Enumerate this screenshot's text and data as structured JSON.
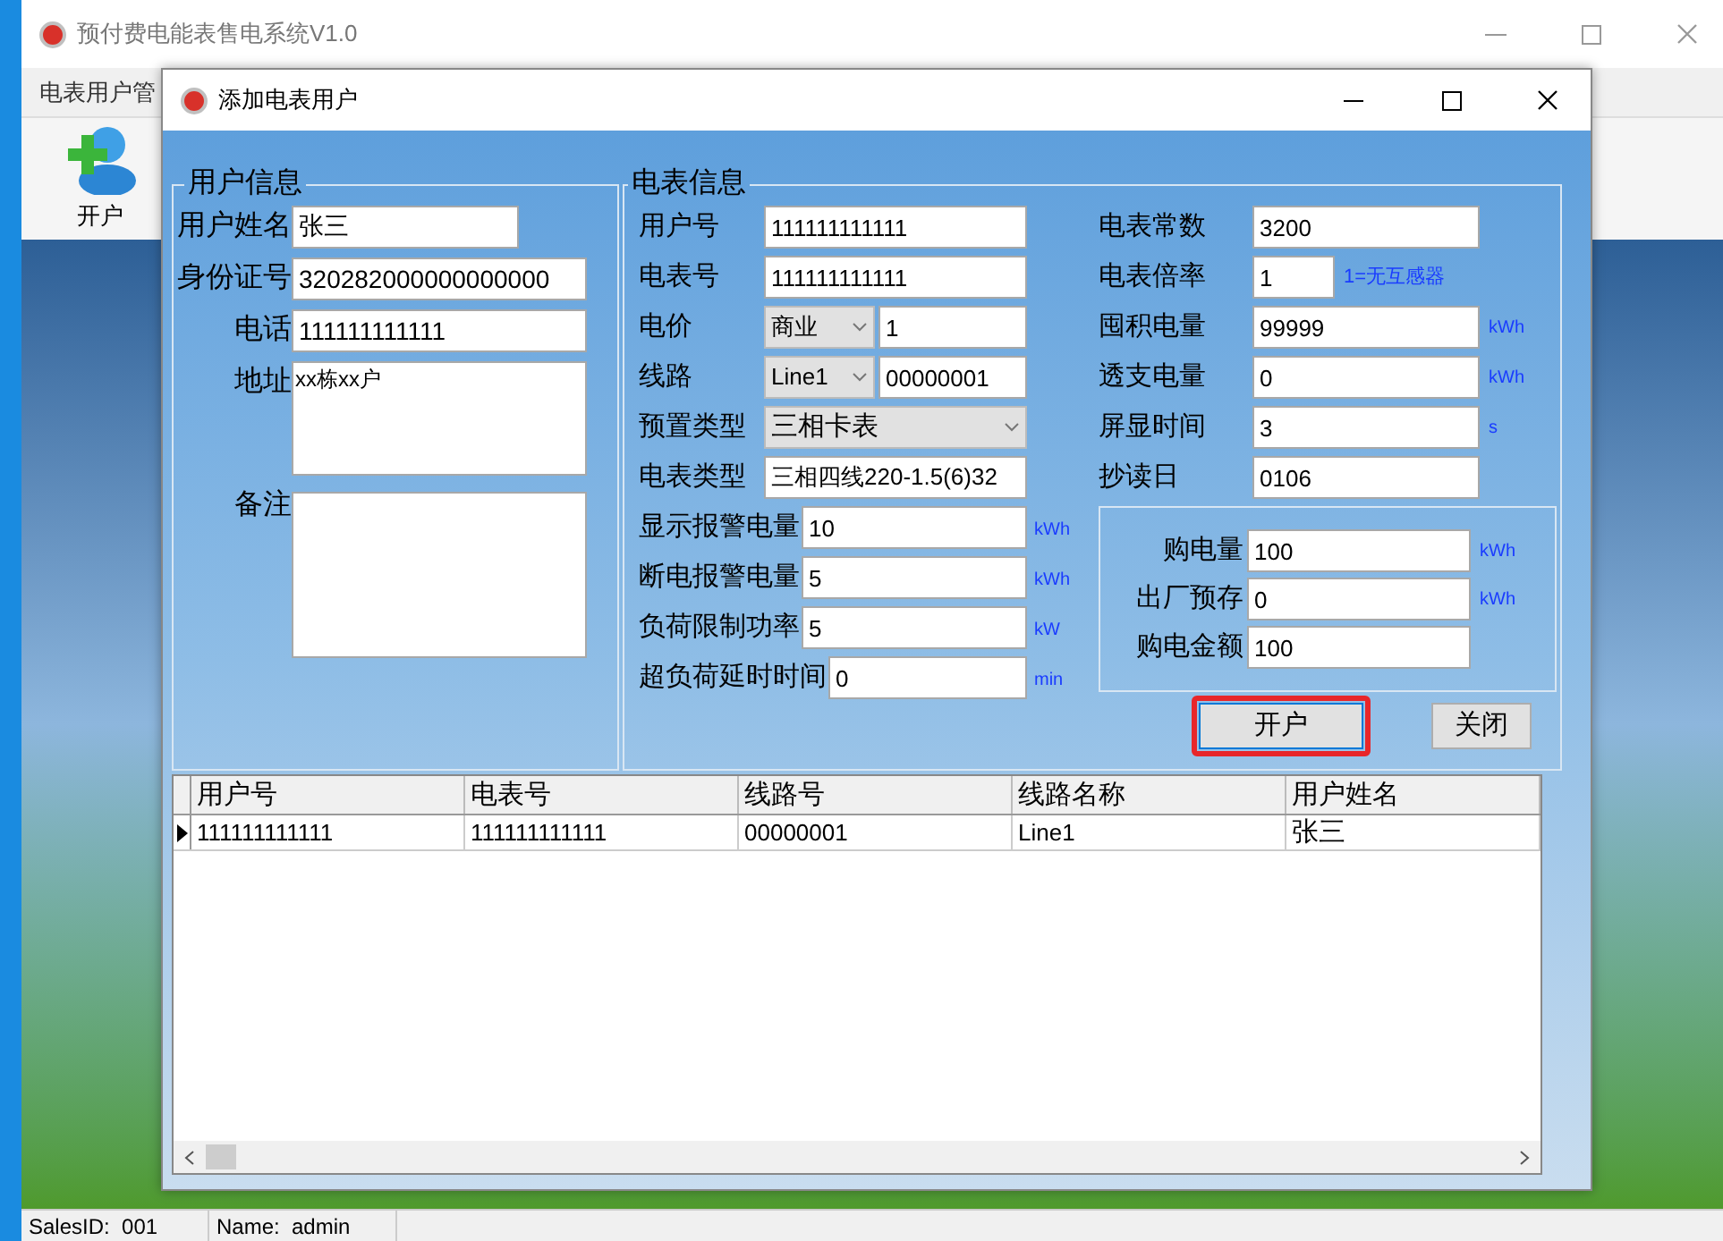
{
  "main_window": {
    "title": "预付费电能表售电系统V1.0",
    "menu": [
      "电表用户管"
    ],
    "toolbar": [
      {
        "label": "开户"
      }
    ],
    "status_bar": [
      "SalesID:  001",
      "Name:  admin"
    ]
  },
  "dialog": {
    "title": "添加电表用户",
    "user_info": {
      "legend": "用户信息",
      "fields": [
        {
          "kind": "input",
          "label": "用户姓名",
          "value": "张三",
          "short": true
        },
        {
          "kind": "input",
          "label": "身份证号",
          "value": "320282000000000000",
          "short": false
        },
        {
          "kind": "input",
          "label": "电话",
          "value": "111111111111",
          "short": false
        },
        {
          "kind": "textarea",
          "label": "地址",
          "value": "xx栋xx户"
        },
        {
          "kind": "textarea",
          "label": "备注"
        }
      ]
    },
    "meter_info": {
      "legend": "电表信息",
      "left_fields": [
        {
          "kind": "input",
          "label": "用户号",
          "value": "111111111111"
        },
        {
          "kind": "input",
          "label": "电表号",
          "value": "111111111111"
        },
        {
          "kind": "combo-input",
          "label": "电价",
          "option": "商业",
          "value": "1"
        },
        {
          "kind": "combo-input",
          "label": "线路",
          "option": "Line1",
          "value": "00000001"
        },
        {
          "kind": "combo",
          "label": "预置类型",
          "option": "三相卡表"
        },
        {
          "kind": "input",
          "label": "电表类型",
          "value": "三相四线220-1.5(6)32"
        },
        {
          "kind": "input",
          "label": "显示报警电量",
          "value": "10",
          "unit": "kWh"
        },
        {
          "kind": "input",
          "label": "断电报警电量",
          "value": "5",
          "unit": "kWh"
        },
        {
          "kind": "input",
          "label": "负荷限制功率",
          "value": "5",
          "unit": "kW"
        },
        {
          "kind": "input",
          "label": "超负荷延时时间",
          "value": "0",
          "unit": "min"
        }
      ],
      "right_fields": [
        {
          "label": "电表常数",
          "value": "3200"
        },
        {
          "label": "电表倍率",
          "value": "1",
          "note": "1=无互感器"
        },
        {
          "label": "囤积电量",
          "value": "99999",
          "unit": "kWh"
        },
        {
          "label": "透支电量",
          "value": "0",
          "unit": "kWh"
        },
        {
          "label": "屏显时间",
          "value": "3",
          "unit": "s"
        },
        {
          "label": "抄读日",
          "value": "0106"
        }
      ],
      "purchase": [
        {
          "label": "购电量",
          "value": "100",
          "unit": "kWh"
        },
        {
          "label": "出厂预存",
          "value": "0",
          "unit": "kWh"
        },
        {
          "label": "购电金额",
          "value": "100"
        }
      ],
      "buttons": [
        {
          "label": "开户",
          "focused": true,
          "highlighted": true
        },
        {
          "label": "关闭",
          "focused": false,
          "highlighted": false
        }
      ]
    },
    "table": {
      "columns": [
        "用户号",
        "电表号",
        "线路号",
        "线路名称",
        "用户姓名"
      ],
      "rows": [
        {
          "current": true,
          "cells": [
            "111111111111",
            "111111111111",
            "00000001",
            "Line1",
            "张三"
          ]
        }
      ]
    }
  }
}
